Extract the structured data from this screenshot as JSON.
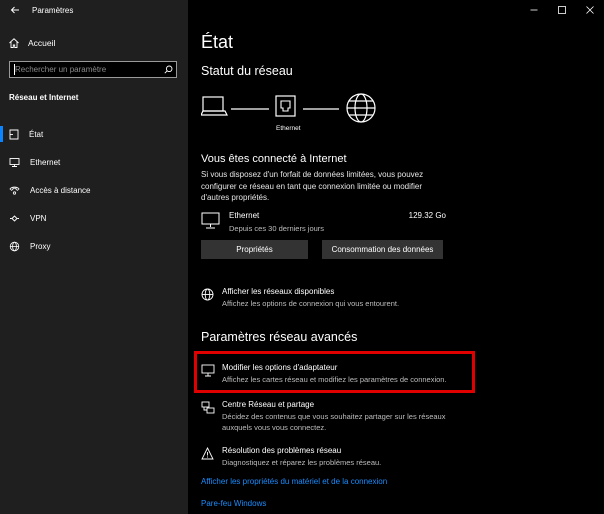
{
  "app": {
    "title": "Paramètres"
  },
  "sidebar": {
    "home_label": "Accueil",
    "search_placeholder": "Rechercher un paramètre",
    "section_title": "Réseau et Internet",
    "items": [
      {
        "label": "État",
        "icon": "home-icon",
        "active": true
      },
      {
        "label": "Ethernet",
        "icon": "ethernet-icon"
      },
      {
        "label": "Accès à distance",
        "icon": "dialup-icon"
      },
      {
        "label": "VPN",
        "icon": "vpn-icon"
      },
      {
        "label": "Proxy",
        "icon": "globe-icon"
      }
    ]
  },
  "main": {
    "title": "État",
    "network_status_heading": "Statut du réseau",
    "diagram_label": "Ethernet",
    "connected_title": "Vous êtes connecté à Internet",
    "connected_text": "Si vous disposez d'un forfait de données limitées, vous pouvez configurer ce réseau en tant que connexion limitée ou modifier d'autres propriétés.",
    "ethernet": {
      "name": "Ethernet",
      "since": "Depuis ces 30 derniers jours",
      "size": "129.32 Go"
    },
    "buttons": {
      "properties": "Propriétés",
      "data_usage": "Consommation des données"
    },
    "show_networks": {
      "title": "Afficher les réseaux disponibles",
      "desc": "Affichez les options de connexion qui vous entourent."
    },
    "advanced_heading": "Paramètres réseau avancés",
    "advanced": [
      {
        "title": "Modifier les options d'adaptateur",
        "desc": "Affichez les cartes réseau et modifiez les paramètres de connexion."
      },
      {
        "title": "Centre Réseau et partage",
        "desc": "Décidez des contenus que vous souhaitez partager sur les réseaux auxquels vous vous connectez."
      },
      {
        "title": "Résolution des problèmes réseau",
        "desc": "Diagnostiquez et réparez les problèmes réseau."
      }
    ],
    "links": {
      "hardware_props": "Afficher les propriétés du matériel et de la connexion",
      "firewall": "Pare-feu Windows"
    }
  },
  "colors": {
    "accent": "#0a84ff",
    "link": "#1a8cff",
    "highlight": "#e00000",
    "sidebar_bg": "#1f1f1f",
    "button_bg": "#333333"
  }
}
